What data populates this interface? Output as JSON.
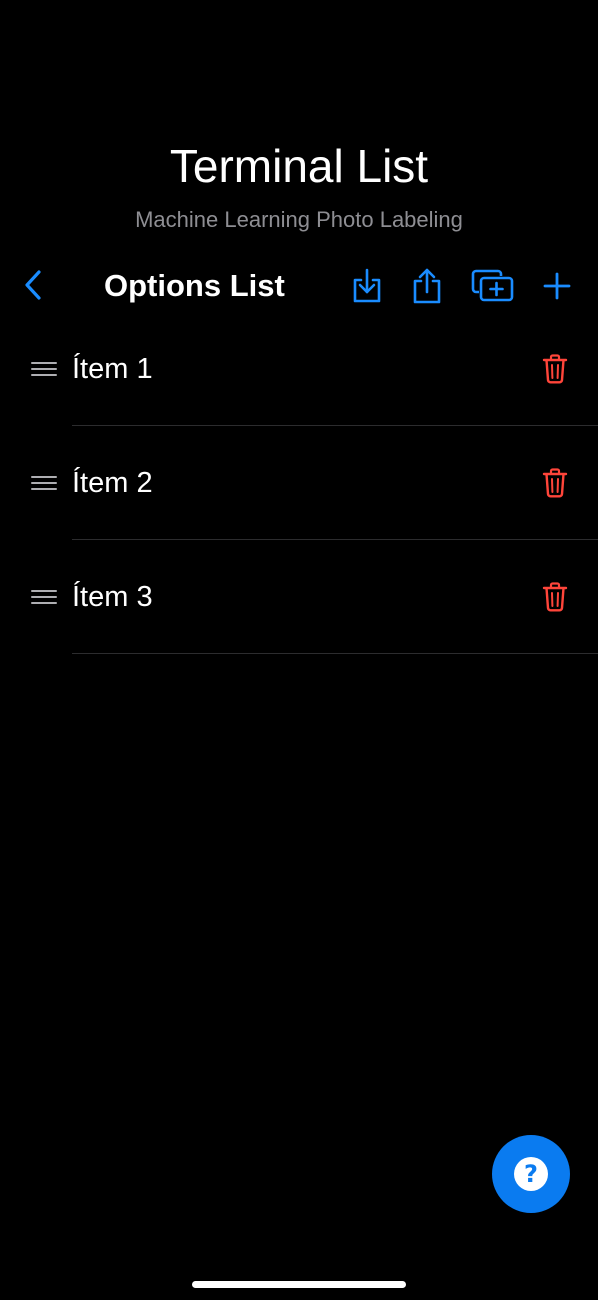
{
  "header": {
    "title": "Terminal List",
    "subtitle": "Machine Learning Photo Labeling"
  },
  "navbar": {
    "title": "Options List",
    "back_icon": "chevron-left-icon",
    "actions": [
      {
        "name": "import-button",
        "icon": "tray-arrow-down-icon"
      },
      {
        "name": "share-button",
        "icon": "share-arrow-up-icon"
      },
      {
        "name": "duplicate-button",
        "icon": "stacked-squares-plus-icon"
      },
      {
        "name": "add-button",
        "icon": "plus-icon"
      }
    ]
  },
  "list": {
    "items": [
      {
        "label": "Ítem 1"
      },
      {
        "label": "Ítem 2"
      },
      {
        "label": "Ítem 3"
      }
    ]
  },
  "help": {
    "glyph": "?"
  },
  "colors": {
    "background": "#000000",
    "accent": "#1a8cff",
    "destructive": "#ff453a",
    "separator": "#2c2c2e",
    "secondary_text": "#8e8e93",
    "help_button": "#0a7bf0"
  }
}
